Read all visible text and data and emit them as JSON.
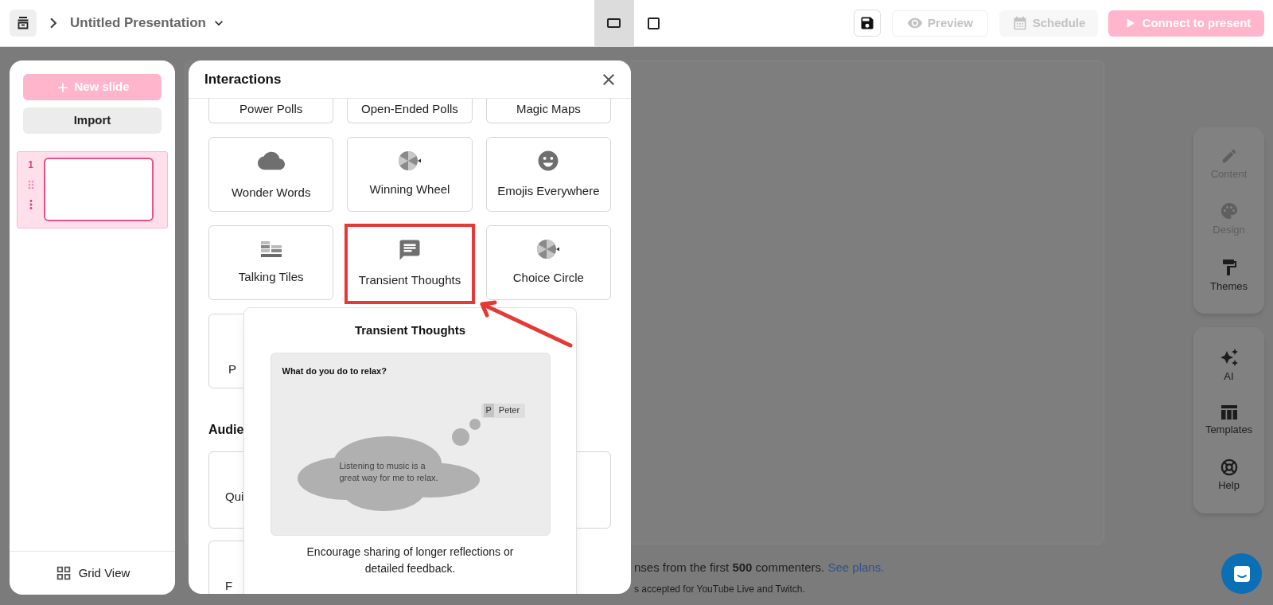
{
  "top_bar": {
    "title": "Untitled Presentation",
    "view_modes": [
      {
        "selected": true
      },
      {
        "selected": false
      }
    ],
    "buttons": [
      {
        "label": "Preview",
        "disabled": true
      },
      {
        "label": "Schedule",
        "disabled": true
      },
      {
        "label": "Connect to present",
        "disabled": true
      }
    ]
  },
  "slides_panel": {
    "new_slide": "New slide",
    "import": "Import",
    "slides": [
      {
        "number": "1",
        "selected": true
      }
    ],
    "grid_view": "Grid View"
  },
  "interactions": {
    "title": "Interactions",
    "cards": [
      {
        "label": "Power Polls",
        "highlighted": false
      },
      {
        "label": "Open-Ended Polls",
        "highlighted": false
      },
      {
        "label": "Magic Maps",
        "highlighted": false
      },
      {
        "label": "Wonder Words",
        "highlighted": false
      },
      {
        "label": "Winning Wheel",
        "highlighted": false
      },
      {
        "label": "Emojis Everywhere",
        "highlighted": false
      },
      {
        "label": "Talking Tiles",
        "highlighted": false
      },
      {
        "label": "Transient Thoughts",
        "highlighted": true
      },
      {
        "label": "Choice Circle",
        "highlighted": false
      },
      {
        "label": "P",
        "highlighted": false
      }
    ],
    "section_heading": "Audie",
    "audience_cards": [
      {
        "label": "Qui"
      },
      {
        "label": "F"
      }
    ]
  },
  "preview": {
    "title": "Transient Thoughts",
    "question": "What do you do to relax?",
    "author_initial": "P",
    "author": "Peter",
    "response": "Listening to music is a great way for me to relax.",
    "description": "Encourage sharing of longer reflections or detailed feedback."
  },
  "footer": {
    "line_1": "nses from the first **500** commenters.",
    "link": "See plans.",
    "line_2": "s accepted for YouTube Live and Twitch."
  },
  "side_toolbar": [
    {
      "items": [
        {
          "label": "Content",
          "disabled": true
        },
        {
          "label": "Design",
          "disabled": true
        },
        {
          "label": "Themes",
          "disabled": false
        }
      ]
    },
    {
      "items": [
        {
          "label": "AI",
          "disabled": false
        },
        {
          "label": "Templates",
          "disabled": false
        },
        {
          "label": "Help",
          "disabled": false
        }
      ]
    }
  ]
}
